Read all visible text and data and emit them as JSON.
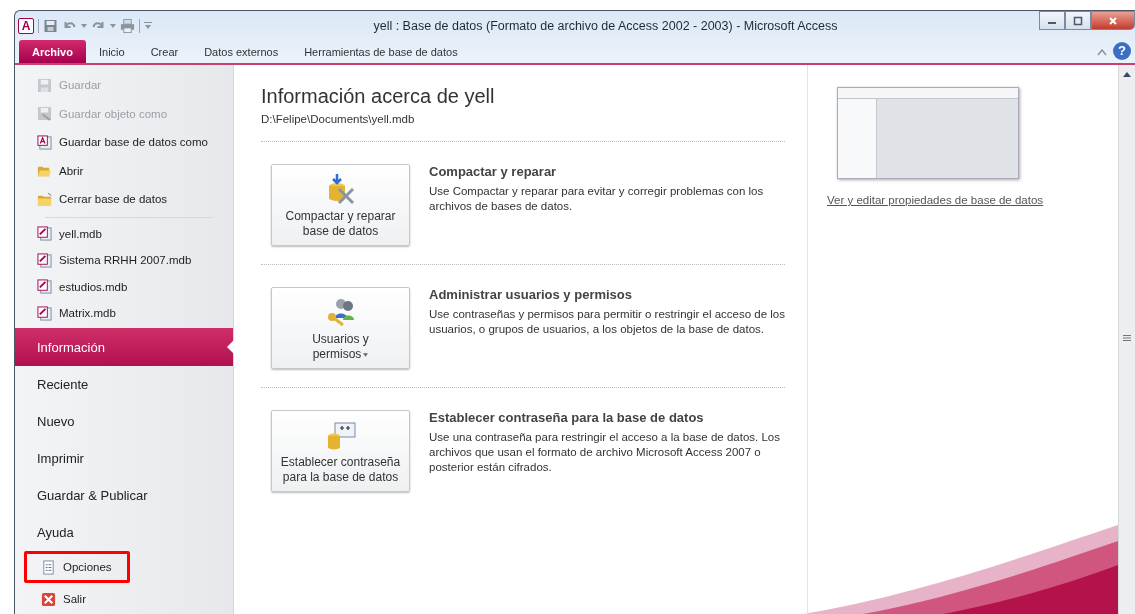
{
  "window": {
    "logo": "A",
    "title": "yell : Base de datos (Formato de archivo de Access 2002 - 2003)  -  Microsoft Access",
    "help": "?"
  },
  "ribbon_tabs": [
    {
      "label": "Archivo",
      "selected": true
    },
    {
      "label": "Inicio",
      "selected": false
    },
    {
      "label": "Crear",
      "selected": false
    },
    {
      "label": "Datos externos",
      "selected": false
    },
    {
      "label": "Herramientas de base de datos",
      "selected": false
    }
  ],
  "sidebar": {
    "commands": [
      {
        "label": "Guardar",
        "kind": "save",
        "disabled": true
      },
      {
        "label": "Guardar objeto como",
        "kind": "save-object",
        "disabled": true
      },
      {
        "label": "Guardar base de datos como",
        "kind": "save-database",
        "disabled": false
      },
      {
        "label": "Abrir",
        "kind": "open-folder",
        "disabled": false
      },
      {
        "label": "Cerrar base de datos",
        "kind": "close-folder",
        "disabled": false
      }
    ],
    "recent_files": [
      "yell.mdb",
      "Sistema RRHH 2007.mdb",
      "estudios.mdb",
      "Matrix.mdb"
    ],
    "nav": [
      {
        "label": "Información",
        "selected": true
      },
      {
        "label": "Reciente",
        "selected": false
      },
      {
        "label": "Nuevo",
        "selected": false
      },
      {
        "label": "Imprimir",
        "selected": false
      },
      {
        "label": "Guardar & Publicar",
        "selected": false
      },
      {
        "label": "Ayuda",
        "selected": false
      }
    ],
    "footer": [
      {
        "label": "Opciones",
        "kind": "options",
        "highlighted": true
      },
      {
        "label": "Salir",
        "kind": "exit",
        "highlighted": false
      }
    ]
  },
  "info": {
    "title": "Información acerca de yell",
    "path": "D:\\Felipe\\Documents\\yell.mdb",
    "sections": [
      {
        "kind": "compact",
        "button": [
          "Compactar y reparar",
          "base de datos"
        ],
        "dropdown": false,
        "title": "Compactar y reparar",
        "description": "Use Compactar y reparar para evitar y corregir problemas con los archivos de bases de datos."
      },
      {
        "kind": "users",
        "button": [
          "Usuarios y",
          "permisos"
        ],
        "dropdown": true,
        "title": "Administrar usuarios y permisos",
        "description": "Use contraseñas y permisos para permitir o restringir el acceso de los usuarios, o grupos de usuarios, a los objetos de la base de datos."
      },
      {
        "kind": "password",
        "button": [
          "Establecer contraseña",
          "para la base de datos"
        ],
        "dropdown": false,
        "title": "Establecer contraseña para la base de datos",
        "description": "Use una contraseña para restringir el acceso a la base de datos. Los archivos que usan el formato de archivo Microsoft Access 2007 o posterior están cifrados."
      }
    ]
  },
  "properties": {
    "link": "Ver y editar propiedades de base de datos"
  }
}
